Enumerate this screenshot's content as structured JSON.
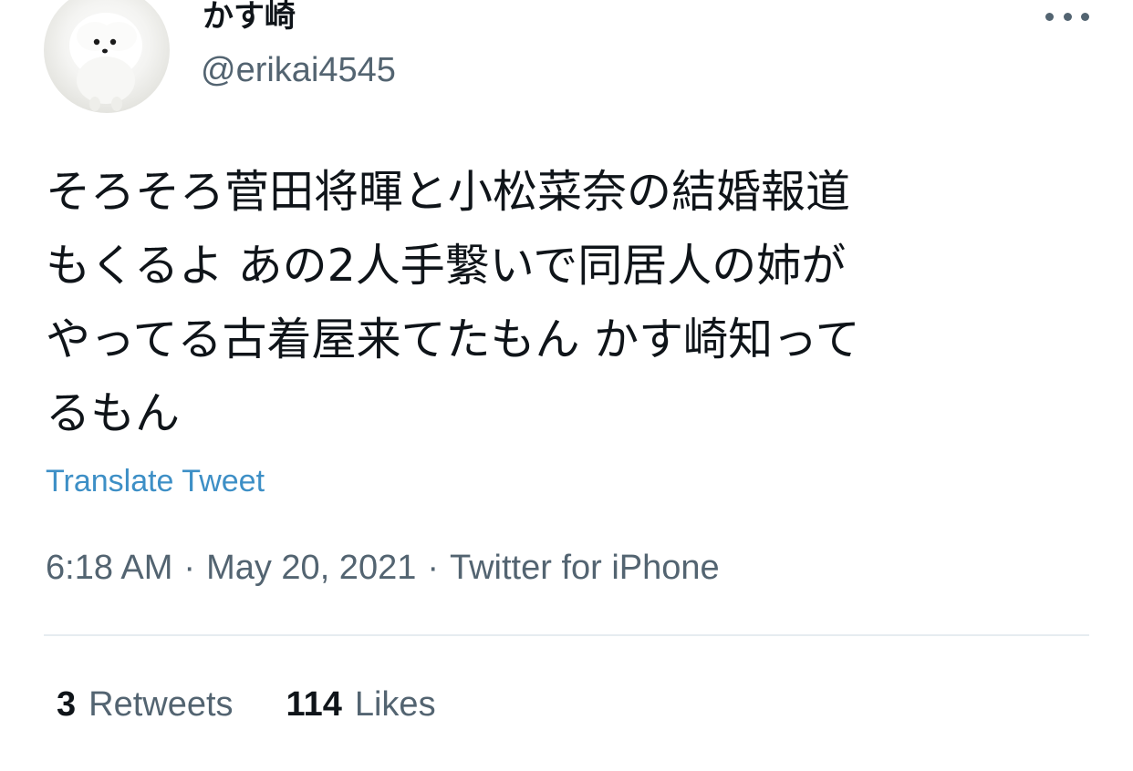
{
  "tweet": {
    "author": {
      "display_name": "かす崎",
      "handle": "@erikai4545",
      "avatar_icon": "pomeranian-dog-avatar"
    },
    "menu_icon": "more-options-icon",
    "text_lines": [
      "そろそろ菅田将暉と小松菜奈の結婚報道",
      "もくるよ あの2人手繋いで同居人の姉が",
      "やってる古着屋来てたもん かす崎知って",
      "るもん"
    ],
    "translate_label": "Translate Tweet",
    "time": "6:18 AM",
    "separator": "·",
    "date": "May 20, 2021",
    "source": "Twitter for iPhone",
    "stats": {
      "retweets_count": "3",
      "retweets_label": "Retweets",
      "likes_count": "114",
      "likes_label": "Likes"
    }
  },
  "colors": {
    "text_primary": "#0f1419",
    "text_secondary": "#536471",
    "link": "#3d8fc6",
    "divider": "#e6ecf0"
  }
}
